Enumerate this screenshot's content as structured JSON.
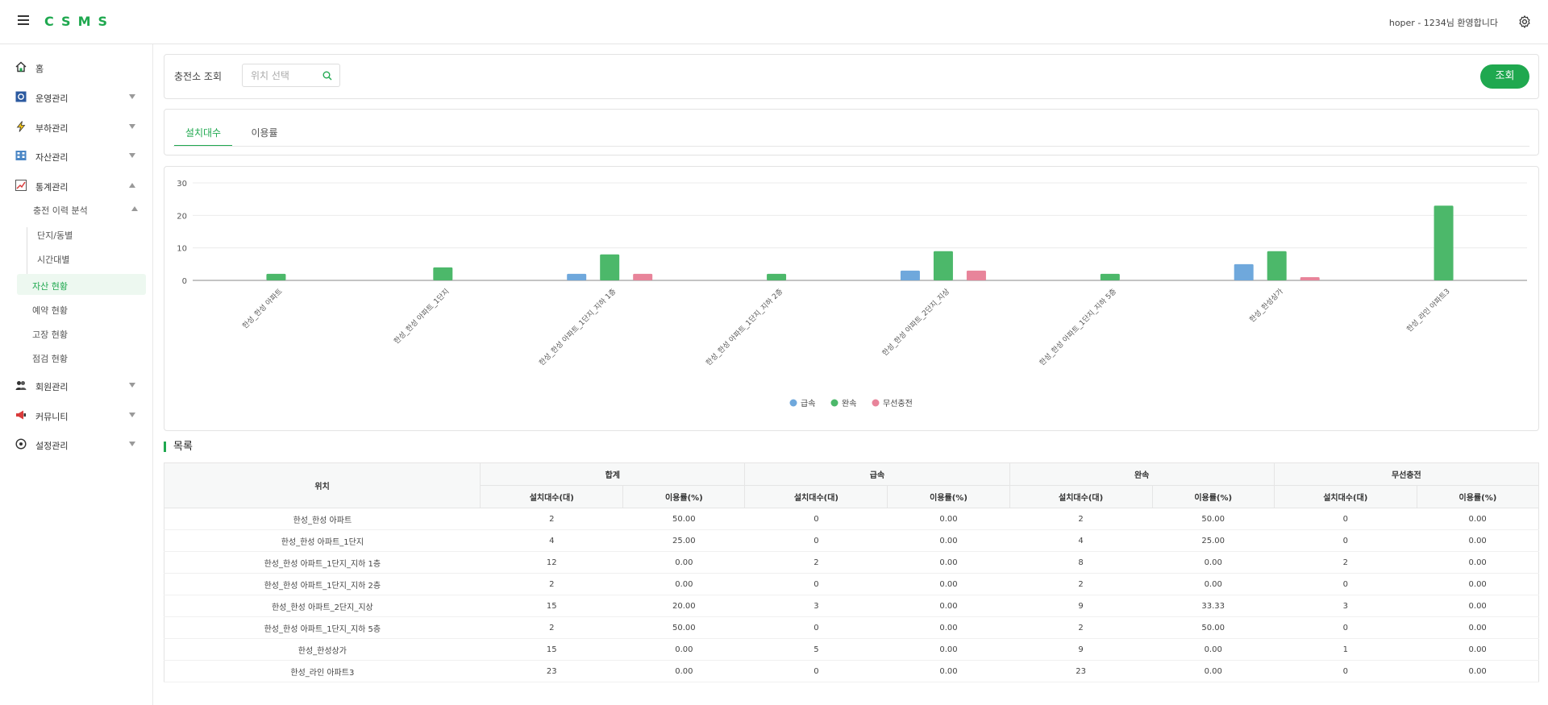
{
  "header": {
    "brand": "CSMS",
    "welcome": "hoper - 1234님 환영합니다"
  },
  "sidebar": {
    "items": [
      {
        "label": "홈",
        "icon": "home-icon"
      },
      {
        "label": "운영관리",
        "icon": "monitor-icon"
      },
      {
        "label": "부하관리",
        "icon": "lightning-icon"
      },
      {
        "label": "자산관리",
        "icon": "building-icon"
      },
      {
        "label": "통계관리",
        "icon": "chart-icon"
      },
      {
        "label": "회원관리",
        "icon": "users-icon"
      },
      {
        "label": "커뮤니티",
        "icon": "megaphone-icon"
      },
      {
        "label": "설정관리",
        "icon": "cog-icon"
      }
    ],
    "submenu": {
      "group": "충전 이력 분석",
      "children": [
        "단지/동별",
        "시간대별"
      ]
    },
    "subitems": [
      "자산 현황",
      "예약 현황",
      "고장 현황",
      "점검 현황"
    ]
  },
  "search": {
    "label": "충전소 조회",
    "placeholder": "위치 선택",
    "button": "조회"
  },
  "tabs": [
    "설치대수",
    "이용률"
  ],
  "chart_data": {
    "type": "bar",
    "categories": [
      "한성_한성 아파트",
      "한성_한성 아파트_1단지",
      "한성_한성 아파트_1단지_지하 1층",
      "한성_한성 아파트_1단지_지하 2층",
      "한성_한성 아파트_2단지_지상",
      "한성_한성 아파트_1단지_지하 5층",
      "한성_한성상가",
      "한성_라인 아파트3"
    ],
    "series": [
      {
        "name": "급속",
        "color": "#6fa8dc",
        "values": [
          0,
          0,
          2,
          0,
          3,
          0,
          5,
          0
        ]
      },
      {
        "name": "완속",
        "color": "#4cb86a",
        "values": [
          2,
          4,
          8,
          2,
          9,
          2,
          9,
          23
        ]
      },
      {
        "name": "무선충전",
        "color": "#e8849a",
        "values": [
          0,
          0,
          2,
          0,
          3,
          0,
          1,
          0
        ]
      }
    ],
    "yticks": [
      0,
      10,
      20,
      30
    ],
    "ylim": [
      0,
      30
    ],
    "grid": true,
    "legend": "bottom-center"
  },
  "list": {
    "title": "목록",
    "location_header": "위치",
    "groups": [
      "합계",
      "급속",
      "완속",
      "무선충전"
    ],
    "sub_headers": [
      "설치대수(대)",
      "이용률(%)"
    ],
    "rows": [
      [
        "한성_한성 아파트",
        "2",
        "50.00",
        "0",
        "0.00",
        "2",
        "50.00",
        "0",
        "0.00"
      ],
      [
        "한성_한성 아파트_1단지",
        "4",
        "25.00",
        "0",
        "0.00",
        "4",
        "25.00",
        "0",
        "0.00"
      ],
      [
        "한성_한성 아파트_1단지_지하 1층",
        "12",
        "0.00",
        "2",
        "0.00",
        "8",
        "0.00",
        "2",
        "0.00"
      ],
      [
        "한성_한성 아파트_1단지_지하 2층",
        "2",
        "0.00",
        "0",
        "0.00",
        "2",
        "0.00",
        "0",
        "0.00"
      ],
      [
        "한성_한성 아파트_2단지_지상",
        "15",
        "20.00",
        "3",
        "0.00",
        "9",
        "33.33",
        "3",
        "0.00"
      ],
      [
        "한성_한성 아파트_1단지_지하 5층",
        "2",
        "50.00",
        "0",
        "0.00",
        "2",
        "50.00",
        "0",
        "0.00"
      ],
      [
        "한성_한성상가",
        "15",
        "0.00",
        "5",
        "0.00",
        "9",
        "0.00",
        "1",
        "0.00"
      ],
      [
        "한성_라인 아파트3",
        "23",
        "0.00",
        "0",
        "0.00",
        "23",
        "0.00",
        "0",
        "0.00"
      ]
    ]
  }
}
